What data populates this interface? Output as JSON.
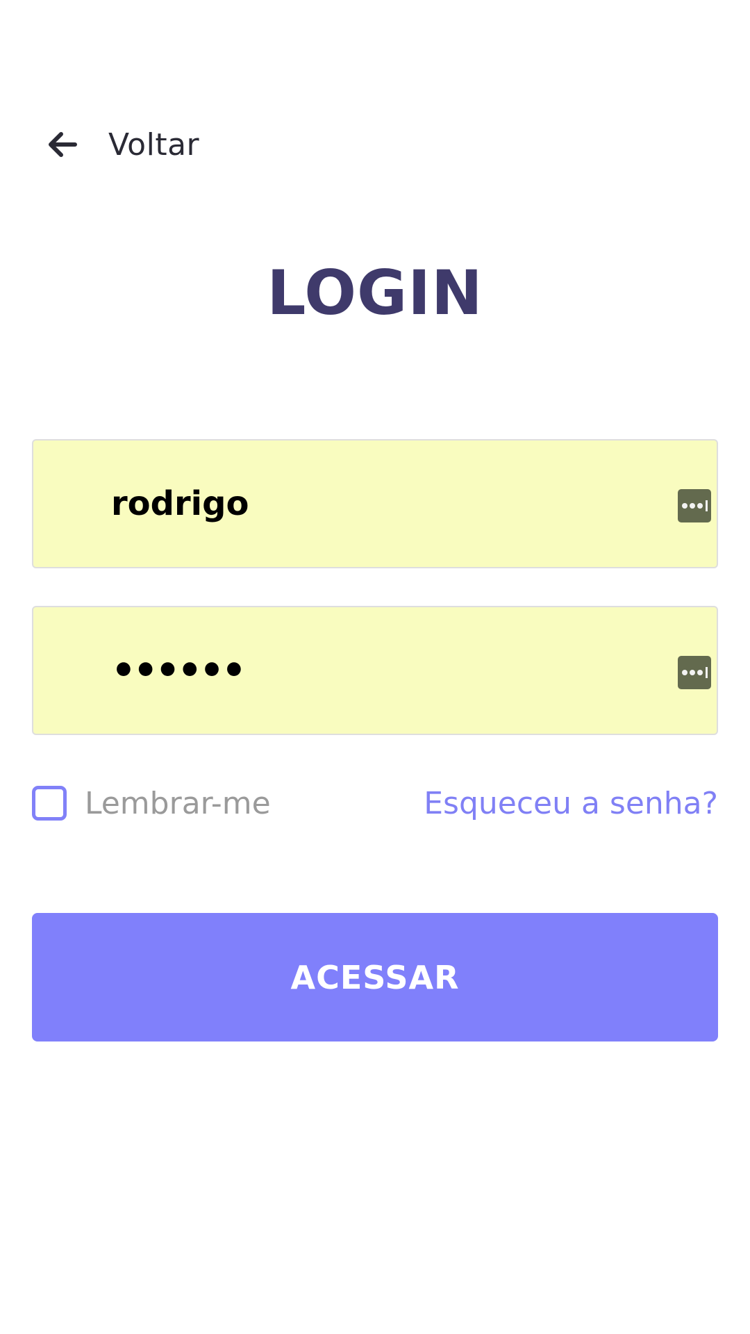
{
  "header": {
    "back_icon": "arrow-left-icon",
    "back_label": "Voltar"
  },
  "title": "LOGIN",
  "form": {
    "username": {
      "value": "rodrigo",
      "autofill_icon": "keychain-autofill-icon"
    },
    "password": {
      "value": "••••••",
      "autofill_icon": "keychain-autofill-icon"
    },
    "remember_label": "Lembrar-me",
    "remember_checked": false,
    "forgot_label": "Esqueceu a senha?",
    "submit_label": "ACESSAR"
  },
  "colors": {
    "title": "#3f3a6b",
    "accent": "#8080fb",
    "autofill_bg": "#f9fcbf",
    "link": "#8080f5",
    "muted_text": "#9a9a9a"
  }
}
